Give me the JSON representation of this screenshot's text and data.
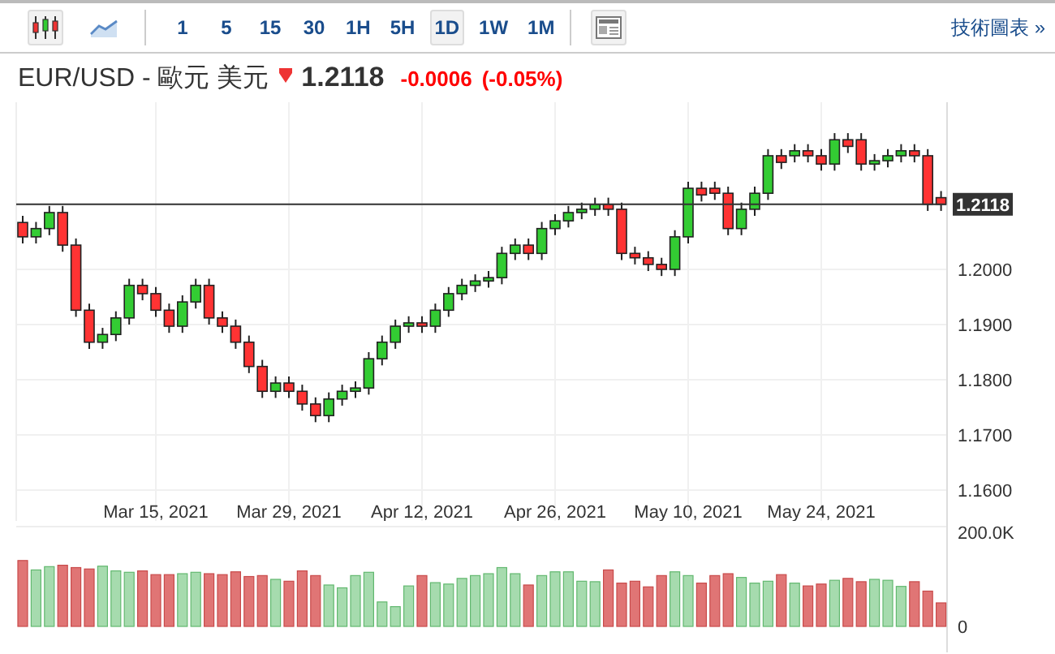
{
  "toolbar": {
    "chart_types": [
      {
        "kind": "candlestick",
        "selected": true
      },
      {
        "kind": "area",
        "selected": false
      }
    ],
    "intervals": [
      {
        "label": "1",
        "selected": false
      },
      {
        "label": "5",
        "selected": false
      },
      {
        "label": "15",
        "selected": false
      },
      {
        "label": "30",
        "selected": false
      },
      {
        "label": "1H",
        "selected": false
      },
      {
        "label": "5H",
        "selected": false
      },
      {
        "label": "1D",
        "selected": true
      },
      {
        "label": "1W",
        "selected": false
      },
      {
        "label": "1M",
        "selected": false
      }
    ],
    "link": "技術圖表 »"
  },
  "quote": {
    "symbol": "EUR/USD - 歐元 美元",
    "falling": true,
    "price": "1.2118",
    "change": "-0.0006",
    "change_percent": "(-0.05%)"
  },
  "price_chart": {
    "chart_data": {
      "type": "candlestick",
      "grid": true,
      "ylim": [
        1.1544,
        1.2303
      ],
      "categories": [
        null,
        null,
        null,
        null,
        null,
        null,
        null,
        null,
        null,
        null,
        "Mar 15, 2021",
        null,
        null,
        null,
        null,
        null,
        null,
        null,
        null,
        null,
        "Mar 29, 2021",
        null,
        null,
        null,
        null,
        null,
        null,
        null,
        null,
        null,
        "Apr 12, 2021",
        null,
        null,
        null,
        null,
        null,
        null,
        null,
        null,
        null,
        "Apr 26, 2021",
        null,
        null,
        null,
        null,
        null,
        null,
        null,
        null,
        null,
        "May 10, 2021",
        null,
        null,
        null,
        null,
        null,
        null,
        null,
        null,
        null,
        "May 24, 2021",
        null,
        null,
        null,
        null,
        null,
        null,
        null,
        null,
        null
      ],
      "yticks": [
        {
          "value": 1.16,
          "label": "1.1600"
        },
        {
          "value": 1.17,
          "label": "1.1700"
        },
        {
          "value": 1.18,
          "label": "1.1800"
        },
        {
          "value": 1.19,
          "label": "1.1900"
        },
        {
          "value": 1.2,
          "label": "1.2000"
        },
        {
          "value": 1.2118,
          "label": "1.2118"
        }
      ],
      "ohlc": [
        [
          1.2085,
          1.2097,
          1.2047,
          1.2059
        ],
        [
          1.2059,
          1.2086,
          1.2047,
          1.2074
        ],
        [
          1.2074,
          1.2115,
          1.2062,
          1.2103
        ],
        [
          1.2103,
          1.2115,
          1.2032,
          1.2044
        ],
        [
          1.2044,
          1.2056,
          1.1914,
          1.1926
        ],
        [
          1.1926,
          1.1938,
          1.1856,
          1.1868
        ],
        [
          1.1868,
          1.1894,
          1.1856,
          1.1882
        ],
        [
          1.1882,
          1.1924,
          1.187,
          1.1912
        ],
        [
          1.1912,
          1.1983,
          1.19,
          1.1971
        ],
        [
          1.1971,
          1.1983,
          1.1944,
          1.1956
        ],
        [
          1.1956,
          1.1968,
          1.1914,
          1.1926
        ],
        [
          1.1926,
          1.1938,
          1.1885,
          1.1897
        ],
        [
          1.1897,
          1.1953,
          1.1885,
          1.1941
        ],
        [
          1.1941,
          1.1983,
          1.1929,
          1.1971
        ],
        [
          1.1971,
          1.1983,
          1.19,
          1.1912
        ],
        [
          1.1912,
          1.1924,
          1.1885,
          1.1897
        ],
        [
          1.1897,
          1.1909,
          1.1856,
          1.1868
        ],
        [
          1.1868,
          1.188,
          1.1812,
          1.1824
        ],
        [
          1.1824,
          1.1836,
          1.1767,
          1.1779
        ],
        [
          1.1779,
          1.1806,
          1.1767,
          1.1794
        ],
        [
          1.1794,
          1.1806,
          1.1767,
          1.1779
        ],
        [
          1.1779,
          1.1791,
          1.1744,
          1.1756
        ],
        [
          1.1756,
          1.1768,
          1.1723,
          1.1735
        ],
        [
          1.1735,
          1.1777,
          1.1723,
          1.1765
        ],
        [
          1.1765,
          1.1791,
          1.1753,
          1.1779
        ],
        [
          1.1779,
          1.1797,
          1.1767,
          1.1785
        ],
        [
          1.1785,
          1.185,
          1.1773,
          1.1838
        ],
        [
          1.1838,
          1.188,
          1.1826,
          1.1868
        ],
        [
          1.1868,
          1.1909,
          1.1856,
          1.1897
        ],
        [
          1.1897,
          1.1915,
          1.1885,
          1.1903
        ],
        [
          1.1903,
          1.1915,
          1.1885,
          1.1897
        ],
        [
          1.1897,
          1.1938,
          1.1885,
          1.1926
        ],
        [
          1.1926,
          1.1968,
          1.1914,
          1.1956
        ],
        [
          1.1956,
          1.1983,
          1.1944,
          1.1971
        ],
        [
          1.1971,
          1.1991,
          1.1959,
          1.1979
        ],
        [
          1.1979,
          1.1997,
          1.1967,
          1.1985
        ],
        [
          1.1985,
          1.2041,
          1.1973,
          1.2029
        ],
        [
          1.2029,
          1.2056,
          1.2017,
          1.2044
        ],
        [
          1.2044,
          1.2056,
          1.2017,
          1.2029
        ],
        [
          1.2029,
          1.2086,
          1.2017,
          1.2074
        ],
        [
          1.2074,
          1.21,
          1.2062,
          1.2088
        ],
        [
          1.2088,
          1.2115,
          1.2076,
          1.2103
        ],
        [
          1.2103,
          1.2121,
          1.2091,
          1.2109
        ],
        [
          1.2109,
          1.213,
          1.2097,
          1.2118
        ],
        [
          1.2118,
          1.213,
          1.2097,
          1.2109
        ],
        [
          1.2109,
          1.2121,
          1.2017,
          1.2029
        ],
        [
          1.2029,
          1.2041,
          1.2009,
          1.2021
        ],
        [
          1.2021,
          1.2033,
          1.1997,
          1.2009
        ],
        [
          1.2009,
          1.2021,
          1.1988,
          1.2
        ],
        [
          1.2,
          1.2071,
          1.1988,
          1.2059
        ],
        [
          1.2059,
          1.2159,
          1.2047,
          1.2147
        ],
        [
          1.2147,
          1.2159,
          1.2123,
          1.2135
        ],
        [
          1.2147,
          1.2159,
          1.2126,
          1.2138
        ],
        [
          1.2138,
          1.215,
          1.2062,
          1.2074
        ],
        [
          1.2074,
          1.2121,
          1.2062,
          1.2109
        ],
        [
          1.2109,
          1.215,
          1.2097,
          1.2138
        ],
        [
          1.2138,
          1.2218,
          1.2126,
          1.2206
        ],
        [
          1.2206,
          1.2218,
          1.2182,
          1.2194
        ],
        [
          1.2206,
          1.2227,
          1.2194,
          1.2215
        ],
        [
          1.2215,
          1.2227,
          1.2194,
          1.2206
        ],
        [
          1.2206,
          1.2218,
          1.2179,
          1.2191
        ],
        [
          1.2191,
          1.2247,
          1.2179,
          1.2235
        ],
        [
          1.2235,
          1.2247,
          1.2211,
          1.2223
        ],
        [
          1.2235,
          1.2247,
          1.2179,
          1.2191
        ],
        [
          1.2191,
          1.2209,
          1.2179,
          1.2197
        ],
        [
          1.2197,
          1.2218,
          1.2185,
          1.2206
        ],
        [
          1.2206,
          1.2227,
          1.2194,
          1.2215
        ],
        [
          1.2215,
          1.2227,
          1.2194,
          1.2206
        ],
        [
          1.2206,
          1.2218,
          1.2106,
          1.2118
        ],
        [
          1.213,
          1.2142,
          1.2106,
          1.2118
        ]
      ],
      "ref_lines": [
        {
          "axis": "y",
          "value": 1.2118,
          "color": "#333333"
        }
      ]
    }
  },
  "volume_chart": {
    "chart_data": {
      "type": "bar",
      "categories": [
        null,
        null,
        null,
        null,
        null,
        null,
        null,
        null,
        null,
        null,
        null,
        null,
        null,
        null,
        null,
        null,
        null,
        null,
        null,
        null,
        null,
        null,
        null,
        null,
        null,
        null,
        null,
        null,
        null,
        null,
        null,
        null,
        null,
        null,
        null,
        null,
        null,
        null,
        null,
        null,
        null,
        null,
        null,
        null,
        null,
        null,
        null,
        null,
        null,
        null,
        null,
        null,
        null,
        null,
        null,
        null,
        null,
        null,
        null,
        null,
        null,
        null,
        null,
        null,
        null,
        null,
        null,
        null,
        null,
        null
      ],
      "ylim": [
        0,
        200000
      ],
      "yticks": [
        {
          "value": 0,
          "label": "0"
        },
        {
          "value": 200000,
          "label": "200.0K"
        }
      ],
      "values": [
        140000,
        120000,
        127000,
        130000,
        125000,
        122000,
        128000,
        118000,
        115000,
        118000,
        110000,
        110000,
        112000,
        115000,
        112000,
        110000,
        116000,
        106000,
        108000,
        100000,
        96000,
        118000,
        108000,
        88000,
        82000,
        108000,
        115000,
        52000,
        42000,
        86000,
        108000,
        93000,
        90000,
        102000,
        108000,
        112000,
        125000,
        112000,
        88000,
        108000,
        116000,
        116000,
        96000,
        95000,
        120000,
        92000,
        96000,
        84000,
        108000,
        116000,
        108000,
        92000,
        108000,
        112000,
        104000,
        92000,
        96000,
        110000,
        92000,
        86000,
        90000,
        98000,
        102000,
        95000,
        100000,
        98000,
        85000,
        95000,
        75000,
        50000
      ]
    }
  }
}
